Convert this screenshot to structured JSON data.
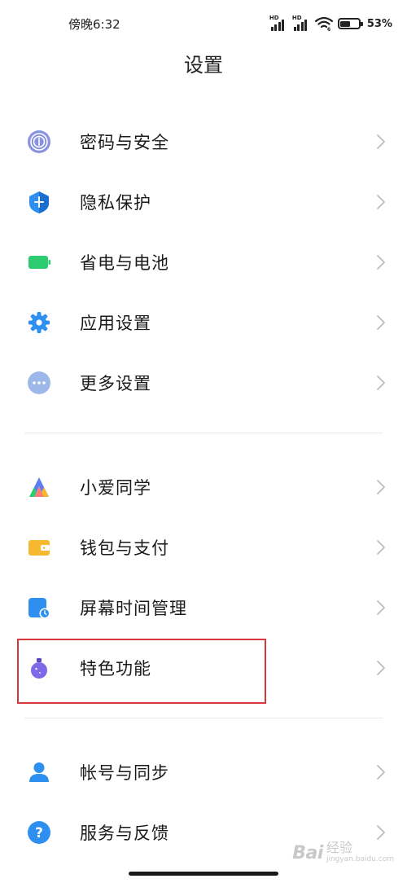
{
  "status_bar": {
    "time": "傍晚6:32",
    "sim1_label": "HD",
    "sim2_label": "HD",
    "wifi_badge": "6",
    "battery_level": 0.53,
    "battery_text": "53%"
  },
  "header": {
    "title": "设置"
  },
  "sections": [
    {
      "items": [
        {
          "label": "密码与安全",
          "icon": "fingerprint-icon",
          "color": "#7b86e0"
        },
        {
          "label": "隐私保护",
          "icon": "privacy-shield-icon",
          "color": "#2f8ff0"
        },
        {
          "label": "省电与电池",
          "icon": "battery-icon",
          "color": "#2ecc71"
        },
        {
          "label": "应用设置",
          "icon": "gear-icon",
          "color": "#2f8ff0"
        },
        {
          "label": "更多设置",
          "icon": "more-dots-icon",
          "color": "#9db7e8"
        }
      ]
    },
    {
      "items": [
        {
          "label": "小爱同学",
          "icon": "xiaoai-icon",
          "color": "#5b7cf2"
        },
        {
          "label": "钱包与支付",
          "icon": "wallet-icon",
          "color": "#f5b82e"
        },
        {
          "label": "屏幕时间管理",
          "icon": "screen-time-icon",
          "color": "#2f8ff0"
        },
        {
          "label": "特色功能",
          "icon": "potion-flask-icon",
          "color": "#7d6ae8"
        }
      ]
    },
    {
      "items": [
        {
          "label": "帐号与同步",
          "icon": "account-icon",
          "color": "#2f8ff0"
        },
        {
          "label": "服务与反馈",
          "icon": "help-icon",
          "color": "#2f8ff0"
        }
      ]
    }
  ],
  "watermark": {
    "logo": "Bai",
    "text": "经验",
    "url": "jingyan.baidu.com"
  },
  "colors": {
    "highlight": "#d9363e",
    "chevron": "#bdbdbd",
    "divider": "#ebebeb"
  }
}
